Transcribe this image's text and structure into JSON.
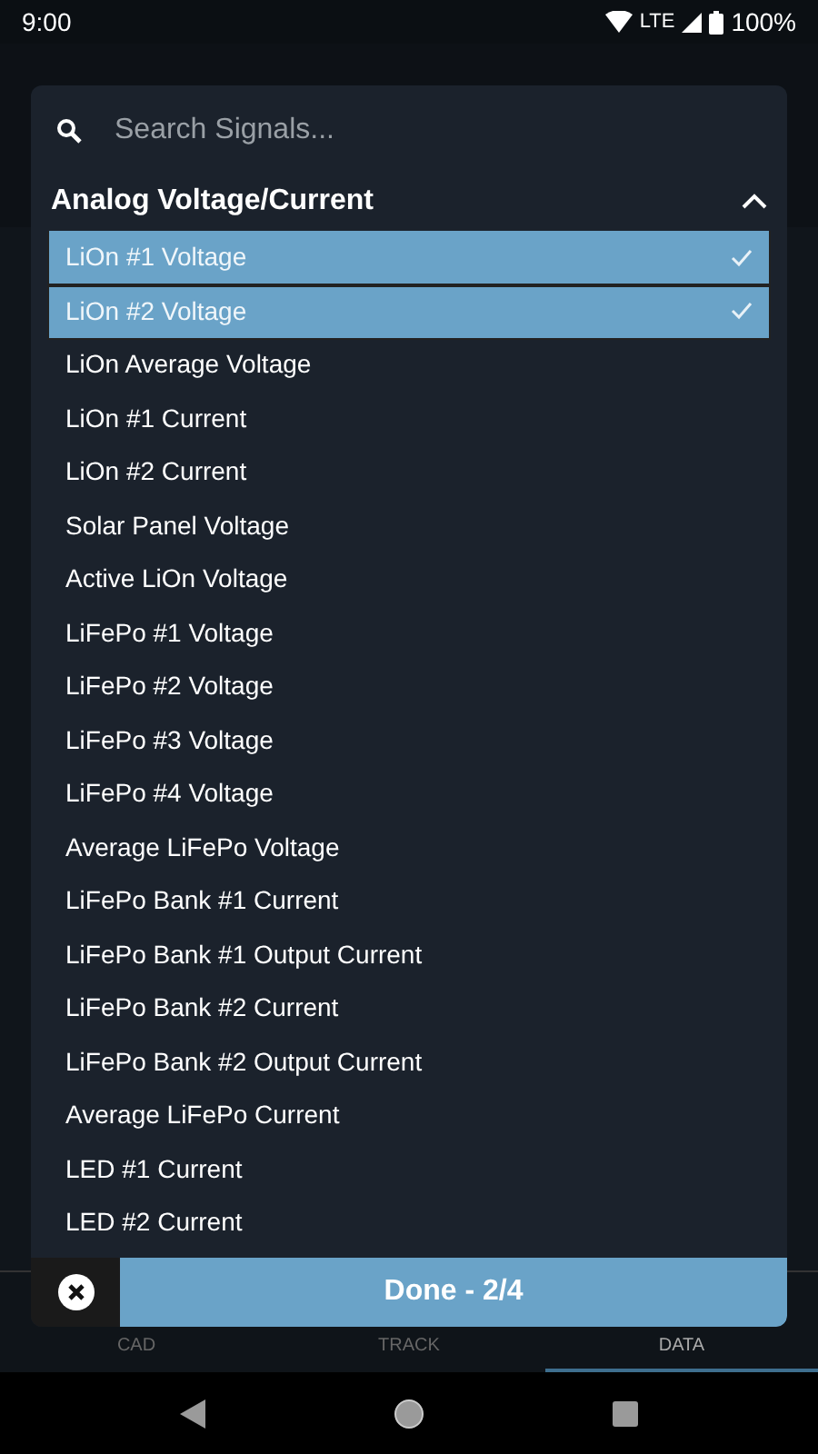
{
  "status_bar": {
    "time": "9:00",
    "network": "LTE",
    "battery": "100%"
  },
  "dialog": {
    "search": {
      "placeholder": "Search Signals..."
    },
    "group": {
      "title": "Analog Voltage/Current",
      "expanded": true,
      "items": [
        {
          "label": "LiOn #1 Voltage",
          "selected": true
        },
        {
          "label": "LiOn #2 Voltage",
          "selected": true
        },
        {
          "label": "LiOn Average Voltage",
          "selected": false
        },
        {
          "label": "LiOn #1 Current",
          "selected": false
        },
        {
          "label": "LiOn #2 Current",
          "selected": false
        },
        {
          "label": "Solar Panel Voltage",
          "selected": false
        },
        {
          "label": "Active LiOn Voltage",
          "selected": false
        },
        {
          "label": "LiFePo #1 Voltage",
          "selected": false
        },
        {
          "label": "LiFePo #2 Voltage",
          "selected": false
        },
        {
          "label": "LiFePo #3 Voltage",
          "selected": false
        },
        {
          "label": "LiFePo #4 Voltage",
          "selected": false
        },
        {
          "label": "Average LiFePo Voltage",
          "selected": false
        },
        {
          "label": "LiFePo Bank #1 Current",
          "selected": false
        },
        {
          "label": "LiFePo Bank #1 Output Current",
          "selected": false
        },
        {
          "label": "LiFePo Bank #2 Current",
          "selected": false
        },
        {
          "label": "LiFePo Bank #2 Output Current",
          "selected": false
        },
        {
          "label": "Average LiFePo Current",
          "selected": false
        },
        {
          "label": "LED #1 Current",
          "selected": false
        },
        {
          "label": "LED #2 Current",
          "selected": false
        }
      ]
    },
    "done_button": "Done - 2/4"
  },
  "bottom_tabs": [
    {
      "label": "CAD",
      "selected": false
    },
    {
      "label": "TRACK",
      "selected": false
    },
    {
      "label": "DATA",
      "selected": true
    }
  ]
}
